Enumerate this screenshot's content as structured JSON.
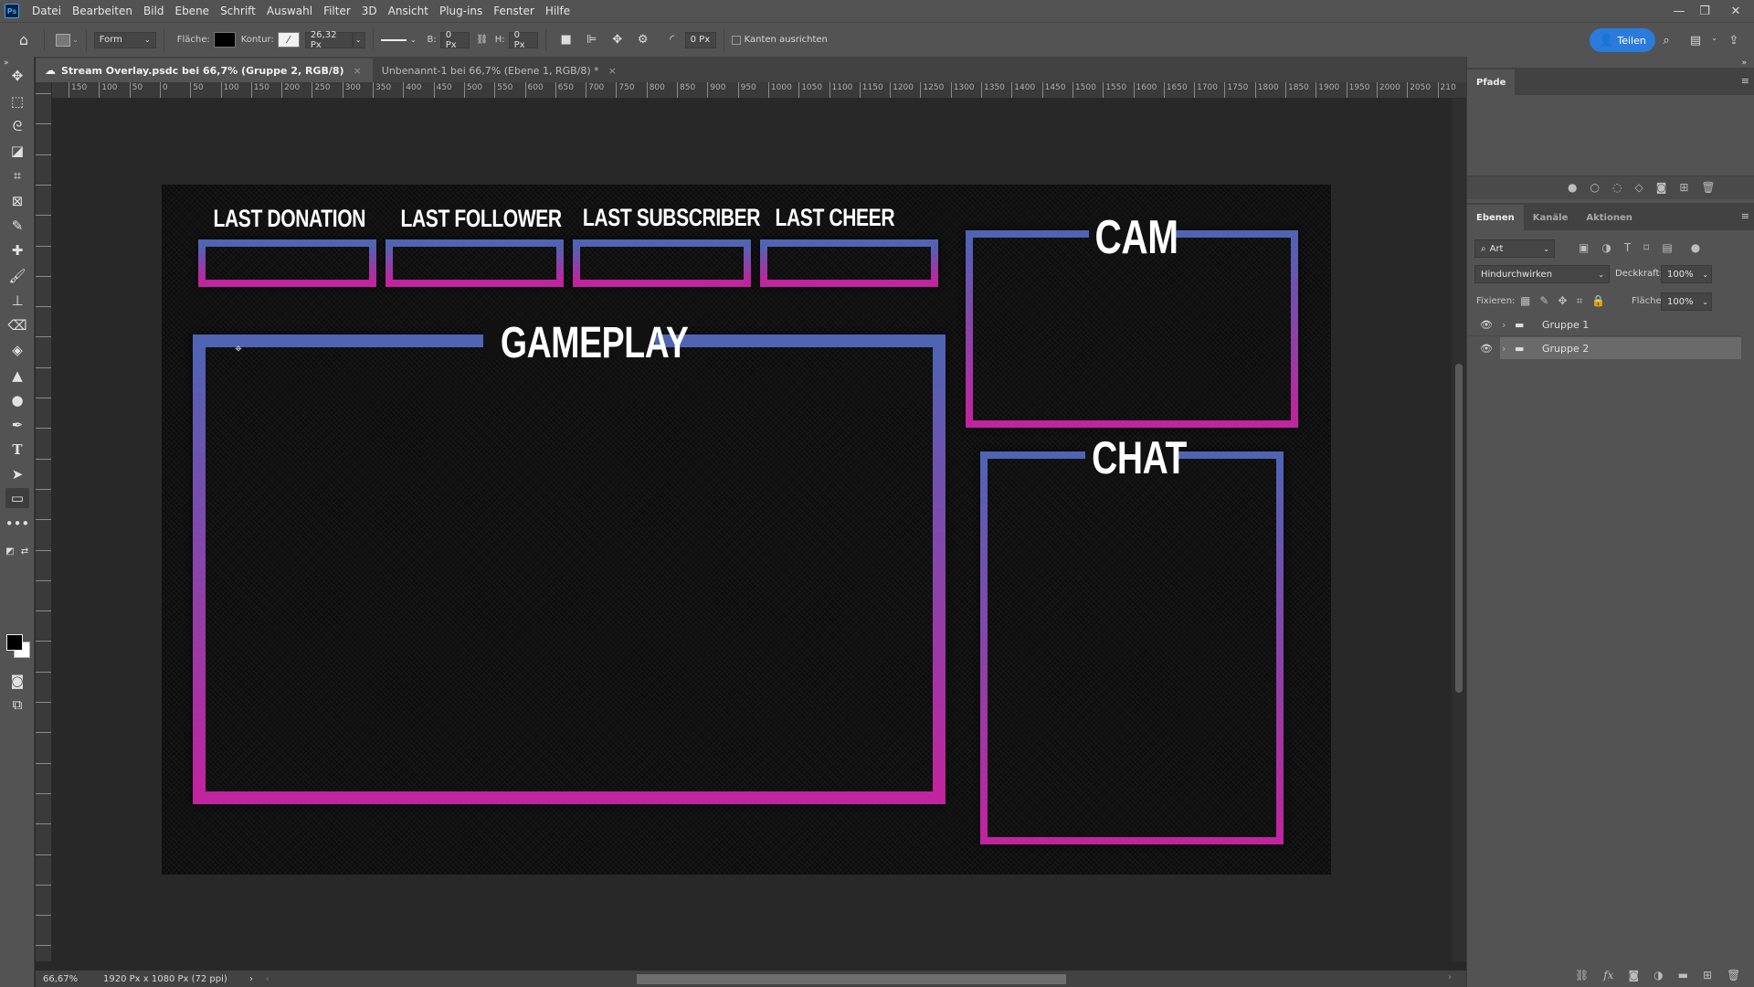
{
  "app": {
    "logo": "Ps",
    "menu": [
      "Datei",
      "Bearbeiten",
      "Bild",
      "Ebene",
      "Schrift",
      "Auswahl",
      "Filter",
      "3D",
      "Ansicht",
      "Plug-ins",
      "Fenster",
      "Hilfe"
    ],
    "window_controls": {
      "minimize": "—",
      "restore": "❐",
      "close": "✕"
    }
  },
  "options_bar": {
    "tool_mode": "Form",
    "fill_label": "Fläche:",
    "fill_color": "#000000",
    "stroke_label": "Kontur:",
    "stroke_width": "26,32 Px",
    "width_label": "B:",
    "width_value": "0 Px",
    "height_label": "H:",
    "height_value": "0 Px",
    "corner_radius": "0 Px",
    "align_edges_label": "Kanten ausrichten",
    "align_edges_checked": false,
    "share_label": "Teilen"
  },
  "tabs": [
    {
      "label": "Stream Overlay.psdc bei 66,7% (Gruppe 2, RGB/8)",
      "active": true,
      "cloud": true
    },
    {
      "label": "Unbenannt-1 bei 66,7% (Ebene 1, RGB/8) *",
      "active": false,
      "cloud": false
    }
  ],
  "ruler": {
    "top_labels": [
      "150",
      "100",
      "50",
      "0",
      "50",
      "100",
      "150",
      "200",
      "250",
      "300",
      "350",
      "400",
      "450",
      "500",
      "550",
      "600",
      "650",
      "700",
      "750",
      "800",
      "850",
      "900",
      "950",
      "1000",
      "1050",
      "1100",
      "1150",
      "1200",
      "1250",
      "1300",
      "1350",
      "1400",
      "1450",
      "1500",
      "1550",
      "1600",
      "1650",
      "1700",
      "1750",
      "1800",
      "1850",
      "1900",
      "1950",
      "2000",
      "2050",
      "210"
    ]
  },
  "canvas": {
    "gradient_top": "#5064b4",
    "gradient_bottom": "#c0249e",
    "info_boxes": [
      "LAST DONATION",
      "LAST FOLLOWER",
      "LAST SUBSCRIBER",
      "LAST CHEER"
    ],
    "gameplay_label": "GAMEPLAY",
    "cam_label": "CAM",
    "chat_label": "CHAT"
  },
  "status_bar": {
    "zoom": "66,67%",
    "doc_info": "1920 Px x 1080 Px (72 ppi)"
  },
  "panels": {
    "paths": {
      "tab": "Pfade"
    },
    "layers": {
      "tabs": [
        "Ebenen",
        "Kanäle",
        "Aktionen"
      ],
      "filter_kind": "Art",
      "blend_mode": "Hindurchwirken",
      "opacity_label": "Deckkraft:",
      "opacity": "100%",
      "lock_label": "Fixieren:",
      "fill_label": "Fläche:",
      "fill": "100%",
      "layers": [
        {
          "name": "Gruppe 1",
          "visible": true,
          "selected": false
        },
        {
          "name": "Gruppe 2",
          "visible": true,
          "selected": true
        }
      ]
    }
  }
}
